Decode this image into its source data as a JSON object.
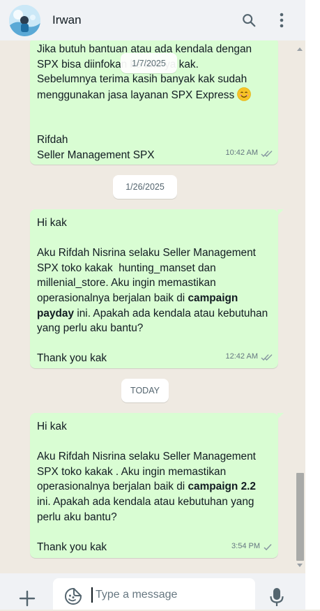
{
  "header": {
    "contact_name": "Irwan",
    "icons": [
      "avatar",
      "search-icon",
      "menu-icon"
    ]
  },
  "messages": [
    {
      "lines": [
        "Jika butuh bantuan atau ada kendala dengan",
        "SPX bisa diinfokan ke aku ya kak.",
        "Sebelumnya terima kasih banyak kak sudah",
        "menggunakan jasa layanan SPX Express"
      ],
      "emoji": "😊",
      "signature_name": "Rifdah",
      "signature_title": "Seller Management SPX",
      "time": "10:42 AM",
      "status": "read"
    },
    {
      "greeting": "Hi kak",
      "body_before": "Aku Rifdah Nisrina selaku Seller Management SPX toko kakak  hunting_manset dan millenial_store. Aku ingin memastikan operasionalnya berjalan baik di ",
      "bold": "campaign payday",
      "body_after": " ini. Apakah ada kendala atau kebutuhan yang perlu aku bantu?",
      "closing": "Thank you kak",
      "time": "12:42 AM",
      "status": "read"
    },
    {
      "greeting": "Hi kak",
      "body_before": "Aku Rifdah Nisrina selaku Seller Management SPX toko kakak . Aku ingin memastikan operasionalnya berjalan baik di ",
      "bold": "campaign 2.2",
      "body_after": " ini. Apakah ada kendala atau kebutuhan yang perlu aku bantu?",
      "closing": "Thank you kak",
      "time": "3:54 PM",
      "status": "sent"
    }
  ],
  "date_separators": {
    "floating": "1/7/2025",
    "second": "1/26/2025",
    "today": "TODAY"
  },
  "composer": {
    "placeholder": "Type a message"
  },
  "colors": {
    "chat_background": "#efeae2",
    "outgoing_bubble": "#d9fdd3",
    "header_background": "#f0f2f5",
    "read_ticks": "#667781"
  }
}
